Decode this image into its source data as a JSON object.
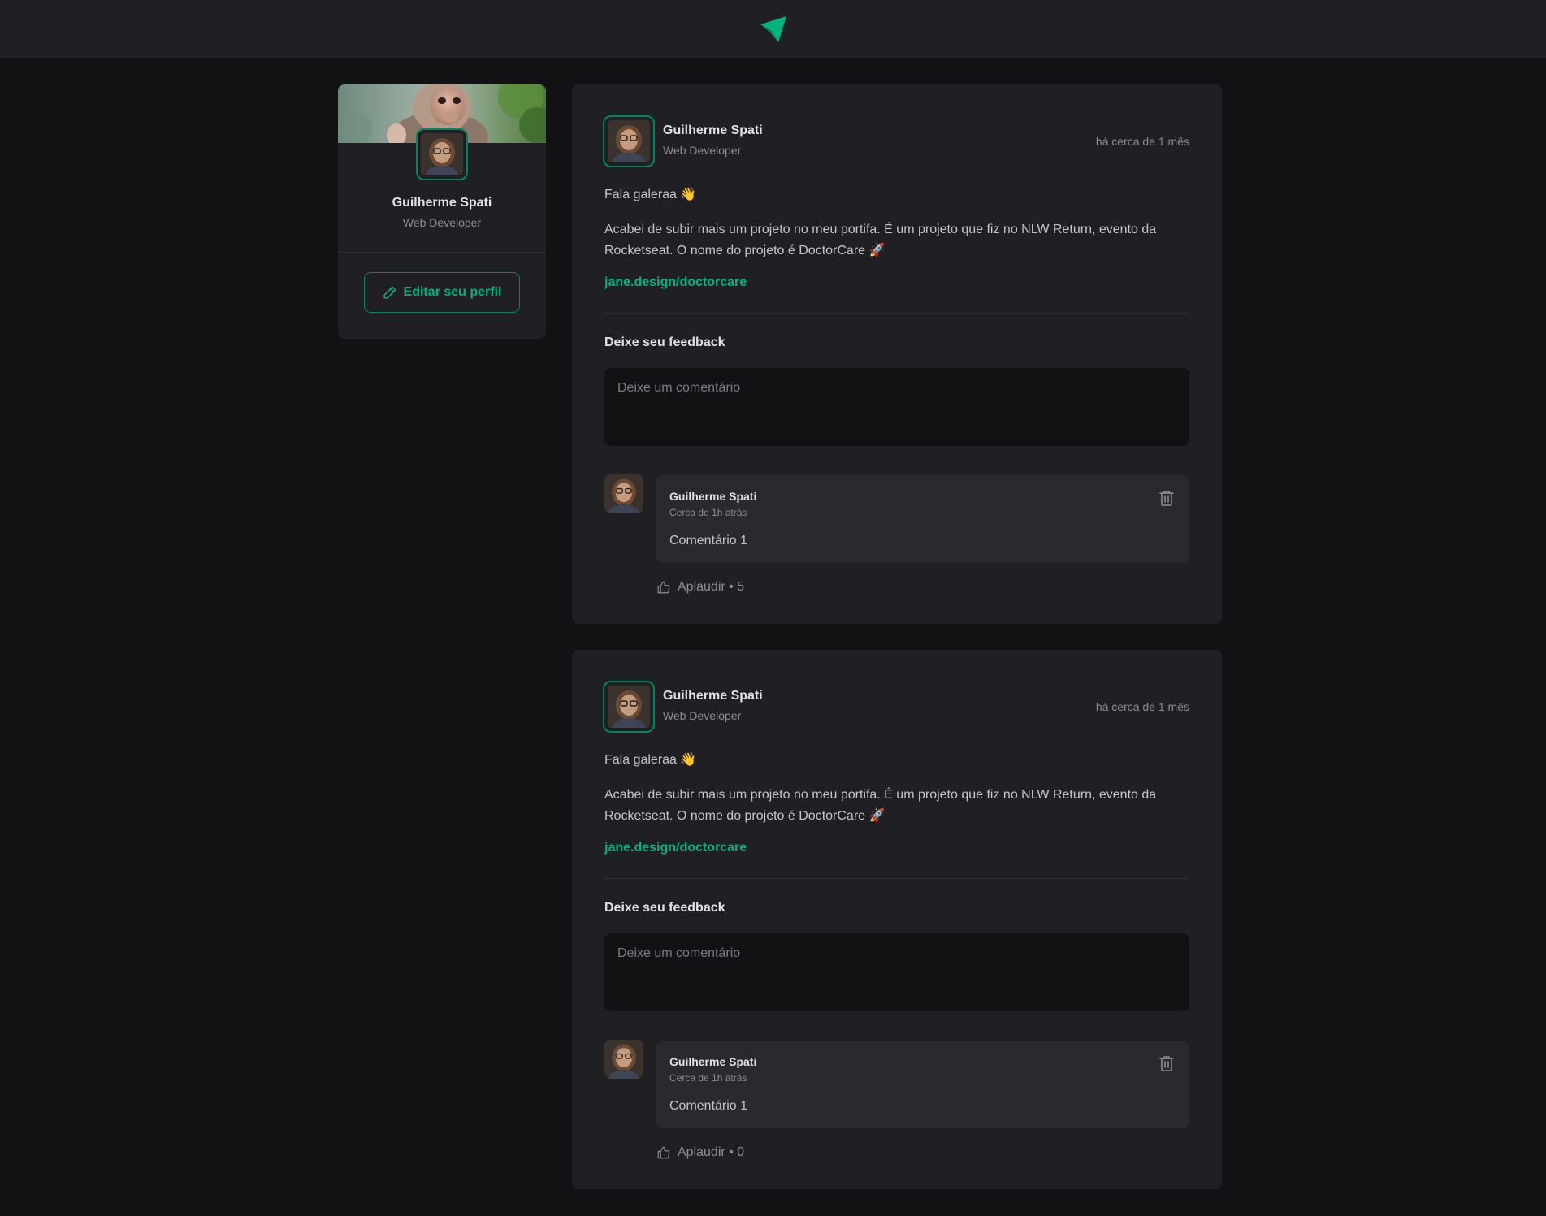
{
  "app": {
    "logo_icon": "paper-plane-logo-icon",
    "accent": "#00875f",
    "accent_light": "#00b37e"
  },
  "profile": {
    "name": "Guilherme Spati",
    "role": "Web Developer",
    "edit_label": "Editar seu perfil",
    "edit_icon": "pencil-icon",
    "cover_image": "monkey-cover-photo"
  },
  "posts": [
    {
      "author": "Guilherme Spati",
      "role": "Web Developer",
      "time": "há cerca de 1 mês",
      "greeting": "Fala galeraa 👋",
      "body": "Acabei de subir mais um projeto no meu portifa. É um projeto que fiz no NLW Return, evento da Rocketseat. O nome do projeto é DoctorCare 🚀",
      "link": "jane.design/doctorcare",
      "feedback_title": "Deixe seu feedback",
      "comment_placeholder": "Deixe um comentário",
      "comment": {
        "author": "Guilherme Spati",
        "time": "Cerca de 1h atrás",
        "text": "Comentário 1",
        "applaud": "Aplaudir • 5"
      }
    },
    {
      "author": "Guilherme Spati",
      "role": "Web Developer",
      "time": "há cerca de 1 mês",
      "greeting": "Fala galeraa 👋",
      "body": "Acabei de subir mais um projeto no meu portifa. É um projeto que fiz no NLW Return, evento da Rocketseat. O nome do projeto é DoctorCare 🚀",
      "link": "jane.design/doctorcare",
      "feedback_title": "Deixe seu feedback",
      "comment_placeholder": "Deixe um comentário",
      "comment": {
        "author": "Guilherme Spati",
        "time": "Cerca de 1h atrás",
        "text": "Comentário 1",
        "applaud": "Aplaudir • 0"
      }
    }
  ]
}
